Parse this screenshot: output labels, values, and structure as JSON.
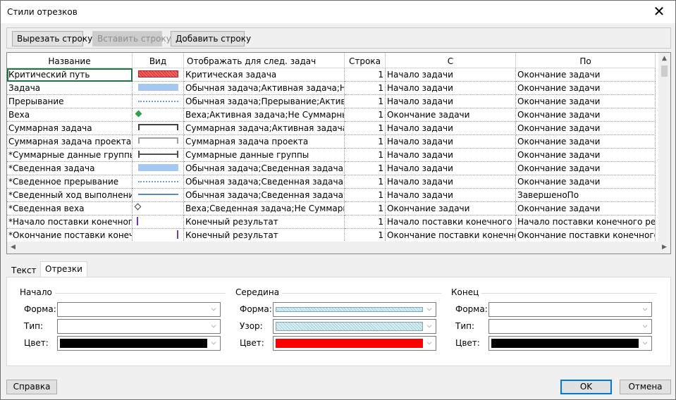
{
  "window": {
    "title": "Стили отрезков",
    "close_glyph": "✕"
  },
  "toolbar": {
    "cut_label": "Вырезать строку",
    "paste_label": "Вставить строку",
    "add_label": "Добавить строку"
  },
  "grid": {
    "headers": [
      "Название",
      "Вид",
      "Отображать для след. задач",
      "Строка",
      "С",
      "По"
    ],
    "rows": [
      {
        "name": "Критический путь",
        "view": "bar-red-hatched",
        "show_for": "Критическая задача",
        "row": "1",
        "from": "Начало задачи",
        "to": "Окончание задачи"
      },
      {
        "name": "Задача",
        "view": "bar-blue",
        "show_for": "Обычная задача;Активная задача;Не",
        "row": "1",
        "from": "Начало задачи",
        "to": "Окончание задачи"
      },
      {
        "name": "Прерывание",
        "view": "dotted-line",
        "show_for": "Обычная задача;Прерывание;Активна",
        "row": "1",
        "from": "Начало задачи",
        "to": "Окончание задачи"
      },
      {
        "name": "Веха",
        "view": "diamond-green",
        "show_for": "Веха;Активная задача;Не Суммарные",
        "row": "1",
        "from": "Окончание задачи",
        "to": "Окончание задачи"
      },
      {
        "name": "Суммарная задача",
        "view": "summary-bracket",
        "show_for": "Суммарная задача;Активная задача;Н",
        "row": "1",
        "from": "Начало задачи",
        "to": "Окончание задачи"
      },
      {
        "name": "Суммарная задача проекта",
        "view": "summary-bracket-light",
        "show_for": "Суммарная задача проекта",
        "row": "1",
        "from": "Начало задачи",
        "to": "Окончание задачи"
      },
      {
        "name": "*Суммарные данные группы",
        "view": "summary-group",
        "show_for": "Суммарные данные группы",
        "row": "1",
        "from": "Начало задачи",
        "to": "Окончание задачи"
      },
      {
        "name": "*Сведенная задача",
        "view": "bar-blue",
        "show_for": "Обычная задача;Сведенная задача;Н",
        "row": "1",
        "from": "Начало задачи",
        "to": "Окончание задачи"
      },
      {
        "name": "*Сведенное прерывание",
        "view": "dotted-line",
        "show_for": "Обычная задача;Сведенная задача;Г",
        "row": "1",
        "from": "Начало задачи",
        "to": "Окончание задачи"
      },
      {
        "name": "*Сведенный ход выполнения",
        "view": "progress-line",
        "show_for": "Обычная задача;Сведенная задача;Н",
        "row": "1",
        "from": "Начало задачи",
        "to": "ЗавершеноПо"
      },
      {
        "name": "*Сведенная веха",
        "view": "diamond-outline",
        "show_for": "Веха;Сведенная задача;Не Суммарна",
        "row": "1",
        "from": "Окончание задачи",
        "to": "Окончание задачи"
      },
      {
        "name": "*Начало поставки конечного",
        "view": "deliverable-start",
        "show_for": "Конечный результат",
        "row": "1",
        "from": "Начало поставки конечного р",
        "to": "Начало поставки конечного рез"
      },
      {
        "name": "*Окончание поставки конечн",
        "view": "deliverable-end",
        "show_for": "Конечный результат",
        "row": "1",
        "from": "Окончание поставки конечно",
        "to": "Окончание поставки конечного"
      }
    ]
  },
  "tabs": [
    {
      "label": "Текст",
      "active": false
    },
    {
      "label": "Отрезки",
      "active": true
    }
  ],
  "panel": {
    "start": {
      "title": "Начало",
      "labels": {
        "shape": "Форма:",
        "type": "Тип:",
        "color": "Цвет:"
      },
      "shape_value": "",
      "type_value": "",
      "color_value": "#000000"
    },
    "middle": {
      "title": "Середина",
      "labels": {
        "shape": "Форма:",
        "pattern": "Узор:",
        "color": "Цвет:"
      },
      "shape_value": "hatched-bar",
      "pattern_value": "hatched",
      "color_value": "#ff0000"
    },
    "end": {
      "title": "Конец",
      "labels": {
        "shape": "Форма:",
        "type": "Тип:",
        "color": "Цвет:"
      },
      "shape_value": "",
      "type_value": "",
      "color_value": "#000000"
    }
  },
  "footer": {
    "help_label": "Справка",
    "ok_label": "OK",
    "cancel_label": "Отмена"
  },
  "colors": {
    "task_blue": "#a4c8f0",
    "critical_red": "#e04040",
    "milestone_green": "#2e9e4f",
    "selection_green": "#217346",
    "focus_blue": "#0078d7"
  }
}
